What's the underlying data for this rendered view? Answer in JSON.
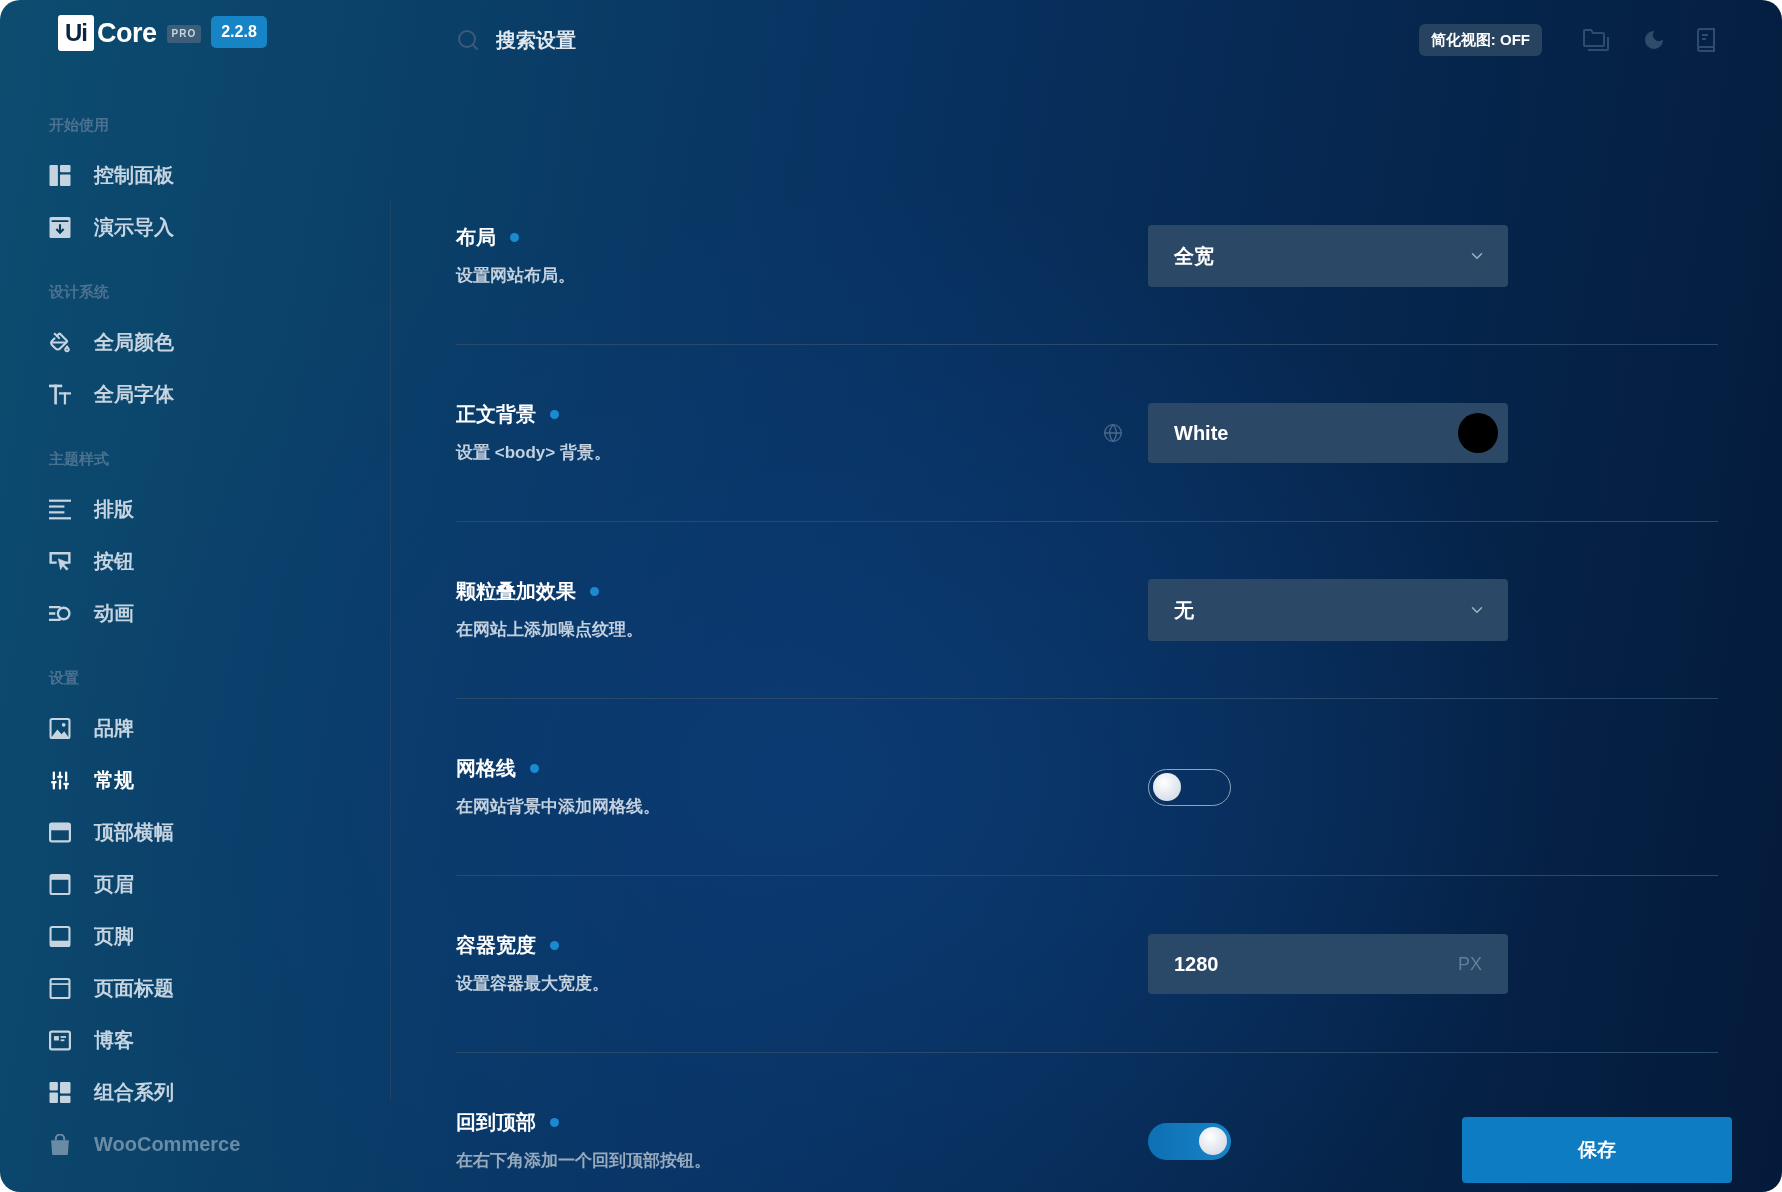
{
  "header": {
    "logo": {
      "mark": "Ui",
      "name": "Core",
      "edition": "PRO",
      "version": "2.2.8"
    },
    "search": {
      "placeholder": "搜索设置"
    },
    "simple_view_toggle": "简化视图: OFF"
  },
  "sidebar": {
    "sections": [
      {
        "title": "开始使用",
        "items": [
          {
            "label": "控制面板",
            "selected": false,
            "disabled": false
          },
          {
            "label": "演示导入",
            "selected": false,
            "disabled": false
          }
        ]
      },
      {
        "title": "设计系统",
        "items": [
          {
            "label": "全局颜色",
            "selected": false,
            "disabled": false
          },
          {
            "label": "全局字体",
            "selected": false,
            "disabled": false
          }
        ]
      },
      {
        "title": "主题样式",
        "items": [
          {
            "label": "排版",
            "selected": false,
            "disabled": false
          },
          {
            "label": "按钮",
            "selected": false,
            "disabled": false
          },
          {
            "label": "动画",
            "selected": false,
            "disabled": false
          }
        ]
      },
      {
        "title": "设置",
        "items": [
          {
            "label": "品牌",
            "selected": false,
            "disabled": false
          },
          {
            "label": "常规",
            "selected": true,
            "disabled": false
          },
          {
            "label": "顶部横幅",
            "selected": false,
            "disabled": false
          },
          {
            "label": "页眉",
            "selected": false,
            "disabled": false
          },
          {
            "label": "页脚",
            "selected": false,
            "disabled": false
          },
          {
            "label": "页面标题",
            "selected": false,
            "disabled": false
          },
          {
            "label": "博客",
            "selected": false,
            "disabled": false
          },
          {
            "label": "组合系列",
            "selected": false,
            "disabled": false
          },
          {
            "label": "WooCommerce",
            "selected": false,
            "disabled": true
          }
        ]
      }
    ]
  },
  "settings": [
    {
      "kind": "select",
      "title": "布局",
      "description": "设置网站布局。",
      "value": "全宽"
    },
    {
      "kind": "color",
      "title": "正文背景",
      "description": "设置 <body> 背景。",
      "value": "White"
    },
    {
      "kind": "select",
      "title": "颗粒叠加效果",
      "description": "在网站上添加噪点纹理。",
      "value": "无"
    },
    {
      "kind": "toggle",
      "title": "网格线",
      "description": "在网站背景中添加网格线。",
      "on": false
    },
    {
      "kind": "number",
      "title": "容器宽度",
      "description": "设置容器最大宽度。",
      "value": "1280",
      "unit": "PX"
    },
    {
      "kind": "toggle",
      "title": "回到顶部",
      "description": "在右下角添加一个回到顶部按钮。",
      "on": true
    }
  ],
  "save_button": "保存"
}
